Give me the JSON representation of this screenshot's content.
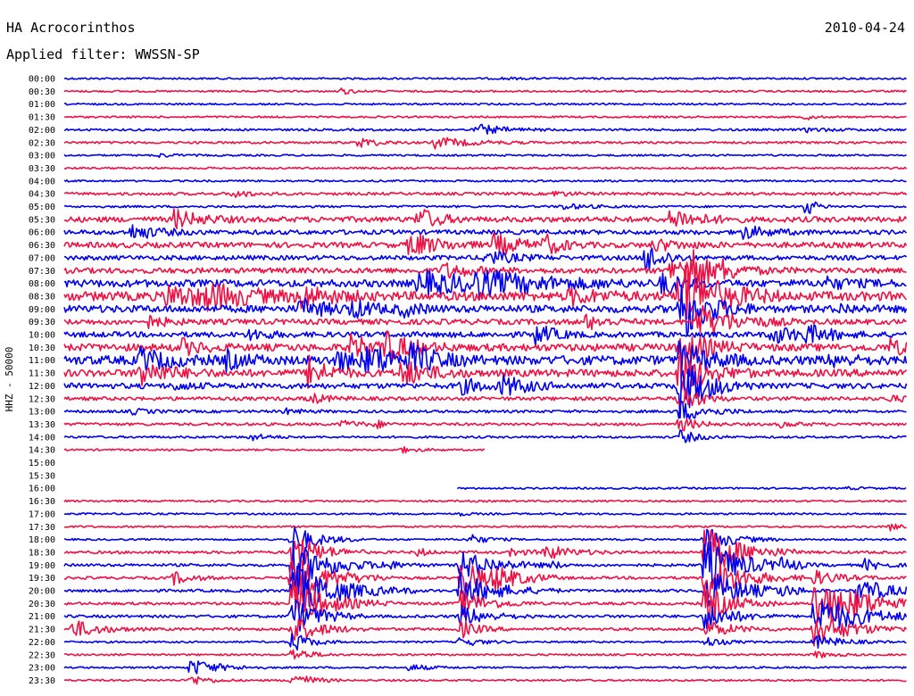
{
  "header": {
    "station": "HA Acrocorinthos",
    "date": "2010-04-24",
    "filter": "Applied filter: WWSSN-SP"
  },
  "colors": {
    "even": "#0000ee",
    "odd": "#ee1144"
  },
  "chart_data": {
    "type": "line",
    "title": "HA Acrocorinthos",
    "ylabel": "HHZ - 50000",
    "yticks": [
      "00:00",
      "00:30",
      "01:00",
      "01:30",
      "02:00",
      "02:30",
      "03:00",
      "03:30",
      "04:00",
      "04:30",
      "05:00",
      "05:30",
      "06:00",
      "06:30",
      "07:00",
      "07:30",
      "08:00",
      "08:30",
      "09:00",
      "09:30",
      "10:00",
      "10:30",
      "11:00",
      "11:30",
      "12:00",
      "12:30",
      "13:00",
      "13:30",
      "14:00",
      "14:30",
      "15:00",
      "15:30",
      "16:00",
      "16:30",
      "17:00",
      "17:30",
      "18:00",
      "18:30",
      "19:00",
      "19:30",
      "20:00",
      "20:30",
      "21:00",
      "21:30",
      "22:00",
      "22:30",
      "23:00",
      "23:30"
    ],
    "xrange_minutes": [
      0,
      30
    ],
    "gap": {
      "start": "14:45",
      "end": "16:14"
    },
    "series": [
      {
        "noise": 1,
        "events": [
          [
            52,
            1,
            2
          ]
        ]
      },
      {
        "noise": 1,
        "events": [
          [
            33,
            4,
            1
          ]
        ]
      },
      {
        "noise": 1,
        "events": []
      },
      {
        "noise": 1,
        "events": [
          [
            88,
            3,
            1
          ]
        ]
      },
      {
        "noise": 1.2,
        "events": [
          [
            49,
            6,
            3
          ],
          [
            88,
            2,
            3
          ]
        ]
      },
      {
        "noise": 1.2,
        "events": [
          [
            35,
            6,
            2
          ],
          [
            44,
            6,
            4
          ]
        ]
      },
      {
        "noise": 1,
        "events": [
          [
            11,
            2,
            2
          ]
        ]
      },
      {
        "noise": 1,
        "events": []
      },
      {
        "noise": 1,
        "events": []
      },
      {
        "noise": 1.5,
        "events": [
          [
            20,
            4,
            2
          ],
          [
            58,
            3,
            2
          ]
        ]
      },
      {
        "noise": 1.2,
        "events": [
          [
            59,
            3,
            3
          ],
          [
            88,
            12,
            1
          ]
        ]
      },
      {
        "noise": 3,
        "events": [
          [
            13,
            10,
            3
          ],
          [
            42,
            14,
            2
          ],
          [
            72,
            12,
            3
          ]
        ]
      },
      {
        "noise": 2.5,
        "events": [
          [
            8,
            8,
            3
          ],
          [
            80,
            8,
            3
          ]
        ]
      },
      {
        "noise": 3,
        "events": [
          [
            41,
            14,
            3
          ],
          [
            51,
            12,
            3
          ],
          [
            57,
            10,
            2
          ],
          [
            70,
            6,
            3
          ]
        ]
      },
      {
        "noise": 2.5,
        "events": [
          [
            50,
            8,
            3
          ],
          [
            69,
            18,
            2
          ]
        ]
      },
      {
        "noise": 3,
        "events": [
          [
            45,
            8,
            3
          ],
          [
            72,
            14,
            2
          ],
          [
            74,
            32,
            2
          ],
          [
            78,
            8,
            3
          ]
        ]
      },
      {
        "noise": 4,
        "events": [
          [
            42,
            12,
            8
          ],
          [
            48,
            10,
            8
          ],
          [
            71,
            12,
            2
          ],
          [
            90,
            6,
            3
          ]
        ]
      },
      {
        "noise": 5,
        "events": [
          [
            12,
            10,
            8
          ],
          [
            17,
            8,
            4
          ],
          [
            28,
            10,
            3
          ],
          [
            60,
            8,
            3
          ],
          [
            73,
            40,
            4
          ]
        ]
      },
      {
        "noise": 4,
        "events": [
          [
            28,
            10,
            3
          ],
          [
            34,
            8,
            3
          ],
          [
            40,
            6,
            2
          ],
          [
            73,
            38,
            3
          ],
          [
            92,
            4,
            2
          ]
        ]
      },
      {
        "noise": 3,
        "events": [
          [
            10,
            6,
            2
          ],
          [
            62,
            8,
            2
          ],
          [
            75,
            20,
            4
          ]
        ]
      },
      {
        "noise": 3,
        "events": [
          [
            22,
            6,
            2
          ],
          [
            56,
            12,
            2
          ],
          [
            84,
            10,
            3
          ],
          [
            88,
            8,
            3
          ]
        ]
      },
      {
        "noise": 4,
        "events": [
          [
            14,
            8,
            2
          ],
          [
            34,
            12,
            3
          ],
          [
            38,
            14,
            3
          ],
          [
            73,
            20,
            3
          ],
          [
            98,
            8,
            2
          ]
        ]
      },
      {
        "noise": 5,
        "events": [
          [
            9,
            12,
            3
          ],
          [
            19,
            10,
            2
          ],
          [
            32,
            10,
            4
          ],
          [
            36,
            12,
            4
          ],
          [
            41,
            12,
            3
          ],
          [
            73,
            20,
            3
          ],
          [
            91,
            6,
            2
          ]
        ]
      },
      {
        "noise": 4,
        "events": [
          [
            9,
            14,
            3
          ],
          [
            29,
            18,
            2
          ],
          [
            40,
            14,
            3
          ],
          [
            73,
            24,
            3
          ]
        ]
      },
      {
        "noise": 3,
        "events": [
          [
            13,
            4,
            2
          ],
          [
            47,
            8,
            3
          ],
          [
            52,
            10,
            3
          ],
          [
            73,
            34,
            3
          ]
        ]
      },
      {
        "noise": 2,
        "events": [
          [
            29,
            6,
            2
          ],
          [
            73,
            18,
            2
          ],
          [
            98,
            3,
            2
          ]
        ]
      },
      {
        "noise": 1.5,
        "events": [
          [
            8,
            3,
            2
          ],
          [
            26,
            3,
            2
          ],
          [
            73,
            12,
            3
          ]
        ]
      },
      {
        "noise": 1.5,
        "events": [
          [
            33,
            4,
            2
          ],
          [
            37,
            4,
            1
          ],
          [
            73,
            8,
            2
          ],
          [
            85,
            3,
            2
          ]
        ]
      },
      {
        "noise": 1.2,
        "events": [
          [
            22,
            4,
            2
          ],
          [
            73,
            8,
            2
          ]
        ]
      },
      {
        "noise": 1,
        "events": [
          [
            40,
            3,
            2
          ]
        ]
      },
      {
        "noise": 0,
        "events": []
      },
      {
        "noise": 0,
        "events": []
      },
      {
        "noise": 1,
        "events": [
          [
            93,
            1,
            2
          ]
        ]
      },
      {
        "noise": 1,
        "events": []
      },
      {
        "noise": 1,
        "events": [
          [
            47,
            2,
            1
          ]
        ]
      },
      {
        "noise": 1,
        "events": [
          [
            98,
            4,
            1
          ]
        ]
      },
      {
        "noise": 1,
        "events": [
          [
            27,
            16,
            3
          ],
          [
            48,
            6,
            2
          ],
          [
            76,
            14,
            3
          ]
        ]
      },
      {
        "noise": 1.5,
        "events": [
          [
            27,
            22,
            3
          ],
          [
            42,
            5,
            1
          ],
          [
            53,
            4,
            2
          ],
          [
            57,
            8,
            3
          ],
          [
            76,
            28,
            4
          ]
        ]
      },
      {
        "noise": 1.5,
        "events": [
          [
            27,
            28,
            4
          ],
          [
            38,
            5,
            2
          ],
          [
            47,
            16,
            4
          ],
          [
            58,
            3,
            1
          ],
          [
            76,
            30,
            4
          ],
          [
            85,
            5,
            2
          ],
          [
            95,
            6,
            2
          ]
        ]
      },
      {
        "noise": 1.5,
        "events": [
          [
            13,
            7,
            2
          ],
          [
            27,
            28,
            4
          ],
          [
            47,
            18,
            4
          ],
          [
            51,
            8,
            3
          ],
          [
            76,
            26,
            4
          ],
          [
            89,
            8,
            3
          ]
        ]
      },
      {
        "noise": 1.5,
        "events": [
          [
            27,
            30,
            5
          ],
          [
            47,
            20,
            4
          ],
          [
            76,
            26,
            4
          ],
          [
            85,
            4,
            2
          ],
          [
            94,
            14,
            4
          ]
        ]
      },
      {
        "noise": 1.5,
        "events": [
          [
            27,
            26,
            4
          ],
          [
            47,
            16,
            3
          ],
          [
            76,
            22,
            3
          ],
          [
            89,
            28,
            5
          ],
          [
            94,
            6,
            2
          ]
        ]
      },
      {
        "noise": 1.5,
        "events": [
          [
            27,
            22,
            3
          ],
          [
            47,
            12,
            3
          ],
          [
            76,
            16,
            3
          ],
          [
            89,
            24,
            5
          ]
        ]
      },
      {
        "noise": 1.5,
        "events": [
          [
            1,
            10,
            3
          ],
          [
            27,
            16,
            3
          ],
          [
            47,
            10,
            2
          ],
          [
            76,
            10,
            3
          ],
          [
            89,
            18,
            4
          ]
        ]
      },
      {
        "noise": 1,
        "events": [
          [
            27,
            12,
            2
          ],
          [
            47,
            6,
            2
          ],
          [
            76,
            6,
            2
          ],
          [
            89,
            8,
            3
          ]
        ]
      },
      {
        "noise": 1,
        "events": [
          [
            27,
            8,
            2
          ],
          [
            89,
            4,
            2
          ]
        ]
      },
      {
        "noise": 1,
        "events": [
          [
            15,
            10,
            3
          ],
          [
            41,
            4,
            2
          ]
        ]
      },
      {
        "noise": 1,
        "events": [
          [
            15,
            6,
            2
          ],
          [
            27,
            10,
            2
          ]
        ]
      }
    ]
  }
}
